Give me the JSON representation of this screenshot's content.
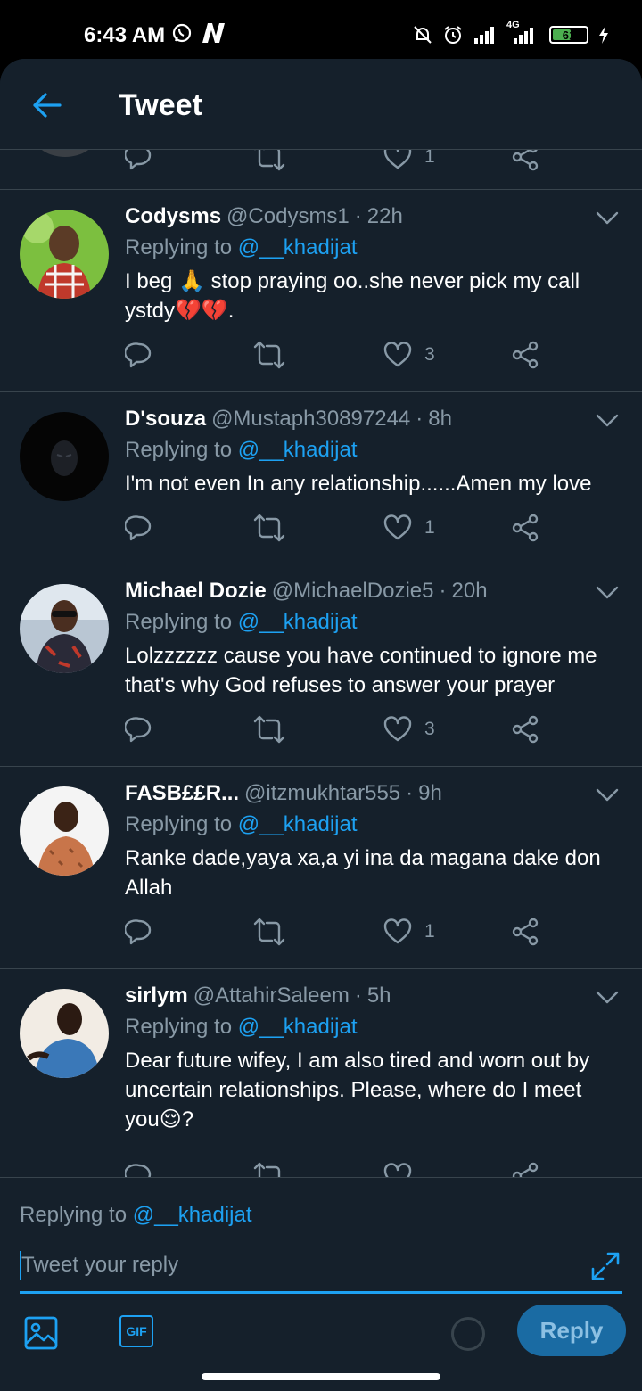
{
  "status_bar": {
    "time": "6:43 AM",
    "network_label": "4G",
    "battery": "61",
    "battery_level": 0.61,
    "icons": [
      "whatsapp-icon",
      "n-app-icon",
      "mute-icon",
      "alarm-icon",
      "signal-icon",
      "signal-4g-icon",
      "battery-icon",
      "charging-icon"
    ]
  },
  "header": {
    "title": "Tweet",
    "back_icon": "arrow-left-icon"
  },
  "previous_tweet": {
    "like_count": "1"
  },
  "tweets": [
    {
      "name": "Codysms",
      "handle": "@Codysms1",
      "sep": "·",
      "time": "22h",
      "replying_prefix": "Replying to",
      "replying_to": "@__khadijat",
      "text": "I beg 🙏 stop praying oo..she never pick my call ystdy💔💔.",
      "likes": "3"
    },
    {
      "name": "D'souza",
      "handle": "@Mustaph30897244",
      "sep": "·",
      "time": "8h",
      "replying_prefix": "Replying to",
      "replying_to": "@__khadijat",
      "text": "I'm not even In any relationship......Amen my love",
      "likes": "1"
    },
    {
      "name": "Michael Dozie",
      "handle": "@MichaelDozie5",
      "sep": "·",
      "time": "20h",
      "replying_prefix": "Replying to",
      "replying_to": "@__khadijat",
      "text": "Lolzzzzzz cause you have continued to ignore me that's why God refuses to answer your prayer",
      "likes": "3"
    },
    {
      "name": "FASB££R...",
      "handle": "@itzmukhtar555",
      "sep": "·",
      "time": "9h",
      "replying_prefix": "Replying to",
      "replying_to": "@__khadijat",
      "text": "Ranke dade,yaya xa,a yi ina da magana dake don Allah",
      "likes": "1"
    },
    {
      "name": "sirlym",
      "handle": "@AttahirSaleem",
      "sep": "·",
      "time": "5h",
      "replying_prefix": "Replying to",
      "replying_to": "@__khadijat",
      "text": "Dear future wifey, I am also tired and worn out by uncertain relationships. Please, where do I meet you😌?",
      "likes": ""
    }
  ],
  "composer": {
    "replying_prefix": "Replying to",
    "replying_to": "@__khadijat",
    "placeholder": "Tweet your reply",
    "image_icon": "image-icon",
    "gif_label": "GIF",
    "reply_label": "Reply"
  },
  "colors": {
    "background": "#15202b",
    "accent": "#1da1f2",
    "secondary_text": "#8899a6",
    "divider": "#38444d"
  }
}
